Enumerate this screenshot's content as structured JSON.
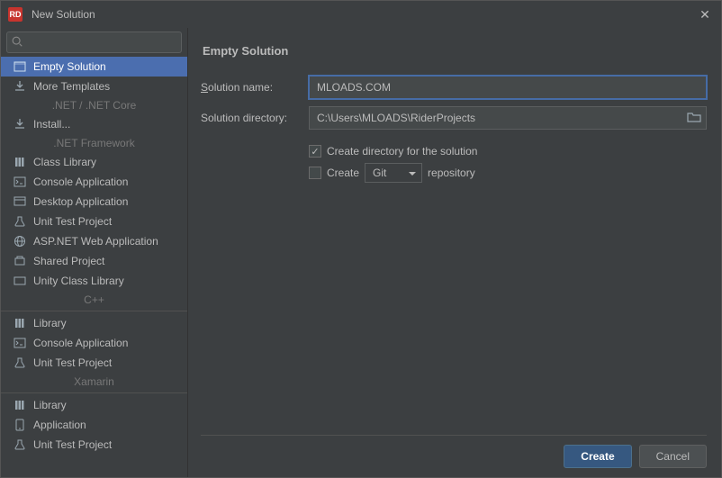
{
  "window": {
    "title": "New Solution",
    "app_badge": "RD"
  },
  "search": {
    "placeholder": ""
  },
  "sidebar": {
    "empty_solution": "Empty Solution",
    "more_templates": "More Templates",
    "cat_net": ".NET / .NET Core",
    "install": "Install...",
    "cat_netfw": ".NET Framework",
    "netfw": {
      "class_library": "Class Library",
      "console_app": "Console Application",
      "desktop_app": "Desktop Application",
      "unit_test": "Unit Test Project",
      "aspnet": "ASP.NET Web Application",
      "shared": "Shared Project",
      "unity": "Unity Class Library"
    },
    "cat_cpp": "C++",
    "cpp": {
      "library": "Library",
      "console_app": "Console Application",
      "unit_test": "Unit Test Project"
    },
    "cat_xamarin": "Xamarin",
    "xam": {
      "library": "Library",
      "application": "Application",
      "unit_test": "Unit Test Project"
    }
  },
  "main": {
    "heading": "Empty Solution",
    "name_label_u": "S",
    "name_label_rest": "olution name:",
    "name_value": "MLOADS.COM",
    "dir_label": "Solution directory:",
    "dir_value": "C:\\Users\\MLOADS\\RiderProjects",
    "create_dir": "Create directory for the solution",
    "create_repo_prefix": "Create",
    "repo_type": "Git",
    "create_repo_suffix": "repository"
  },
  "footer": {
    "create": "Create",
    "cancel": "Cancel"
  }
}
